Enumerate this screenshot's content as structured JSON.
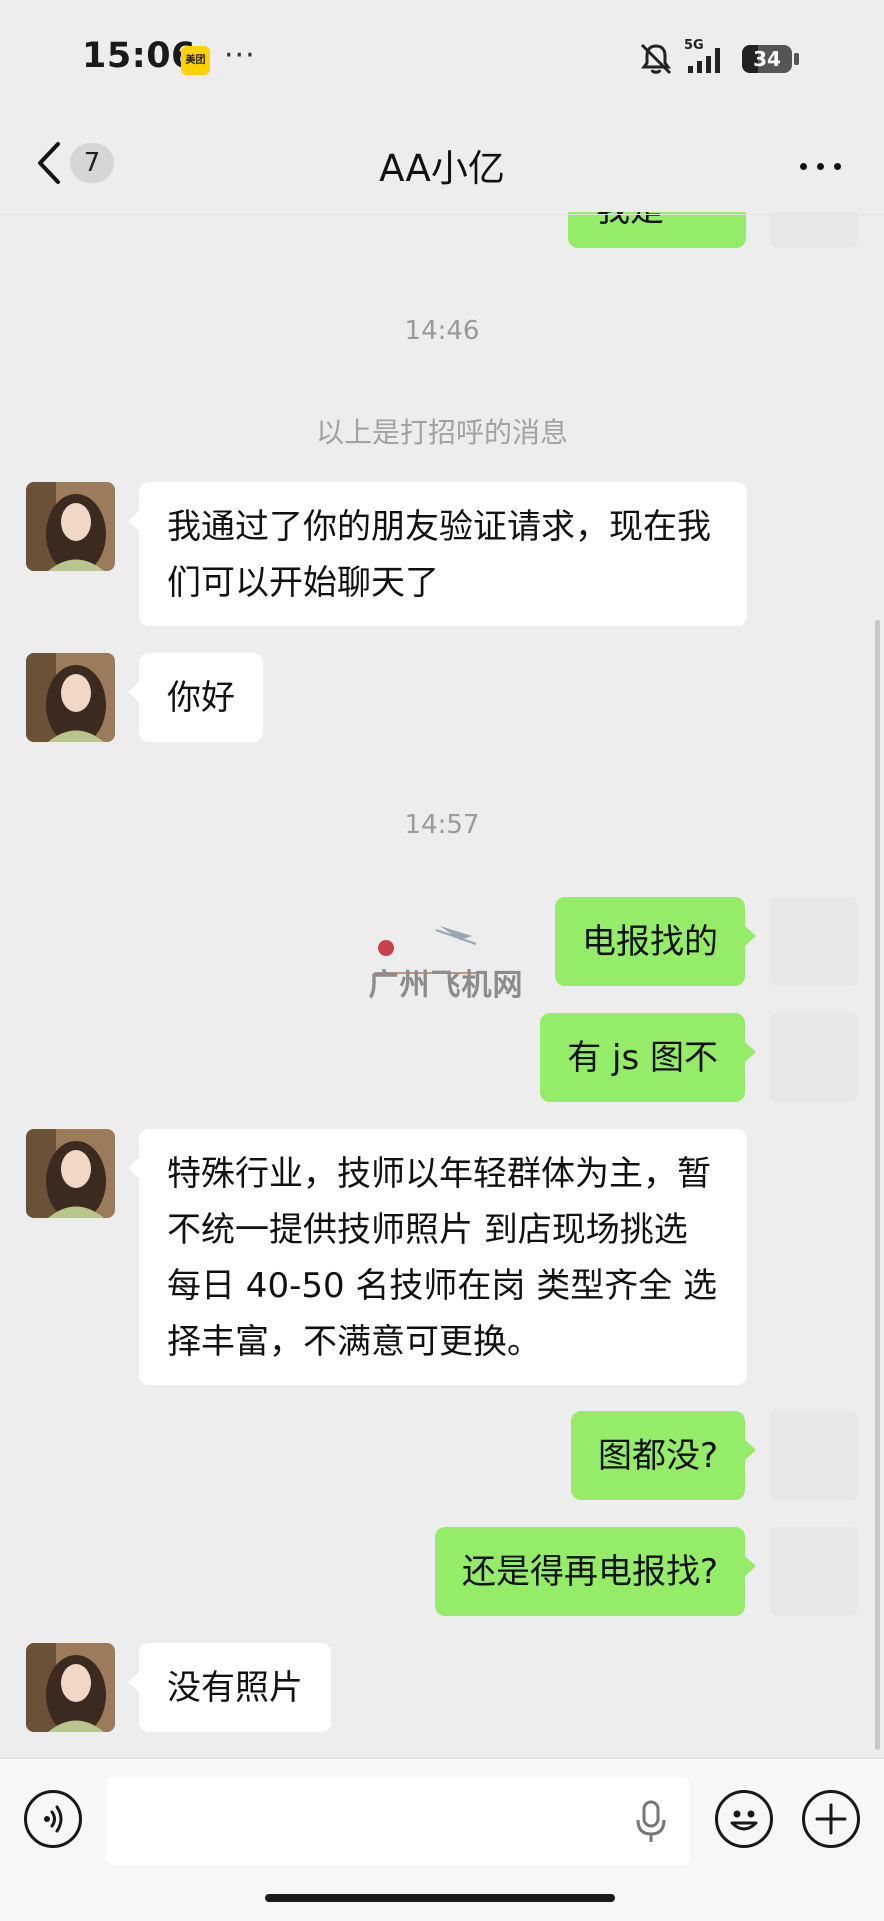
{
  "status_bar": {
    "time": "15:06",
    "app_badge": "美团",
    "more": "···",
    "network": "5G",
    "battery": "34"
  },
  "nav": {
    "unread_count": "7",
    "title": "AA小亿"
  },
  "messages": {
    "partial_sent_text": "我是",
    "time1": "14:46",
    "system_note": "以上是打招呼的消息",
    "msg1": "我通过了你的朋友验证请求，现在我们可以开始聊天了",
    "msg2": "你好",
    "time2": "14:57",
    "msg3": "电报找的",
    "msg4": "有 js 图不",
    "msg5": "特殊行业，技师以年轻群体为主，暂不统一提供技师照片 到店现场挑选 每日 40-50 名技师在岗 类型齐全 选择丰富，不满意可更换。",
    "msg6": "图都没?",
    "msg7": "还是得再电报找?",
    "msg8": "没有照片"
  },
  "watermark": "广州飞机网",
  "input": {
    "placeholder": ""
  },
  "colors": {
    "sent_bubble": "#95ec69",
    "received_bubble": "#ffffff",
    "background": "#ededed"
  }
}
